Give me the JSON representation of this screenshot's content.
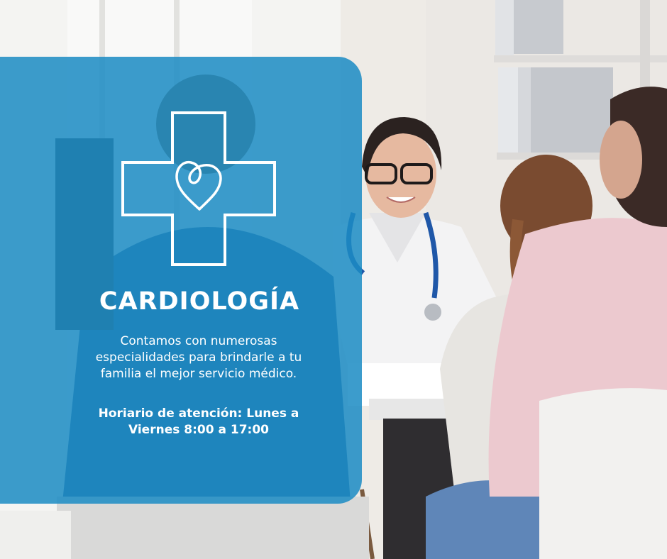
{
  "card": {
    "title": "CARDIOLOGÍA",
    "description": "Contamos con numerosas especialidades para brindarle a tu familia el mejor servicio médico.",
    "hours": "Horiario de atención: Lunes a Viernes 8:00 a 17:00"
  },
  "colors": {
    "panel": "#1c8cc4",
    "text": "#ffffff"
  },
  "icons": {
    "logo": "medical-cross-heart-icon"
  }
}
